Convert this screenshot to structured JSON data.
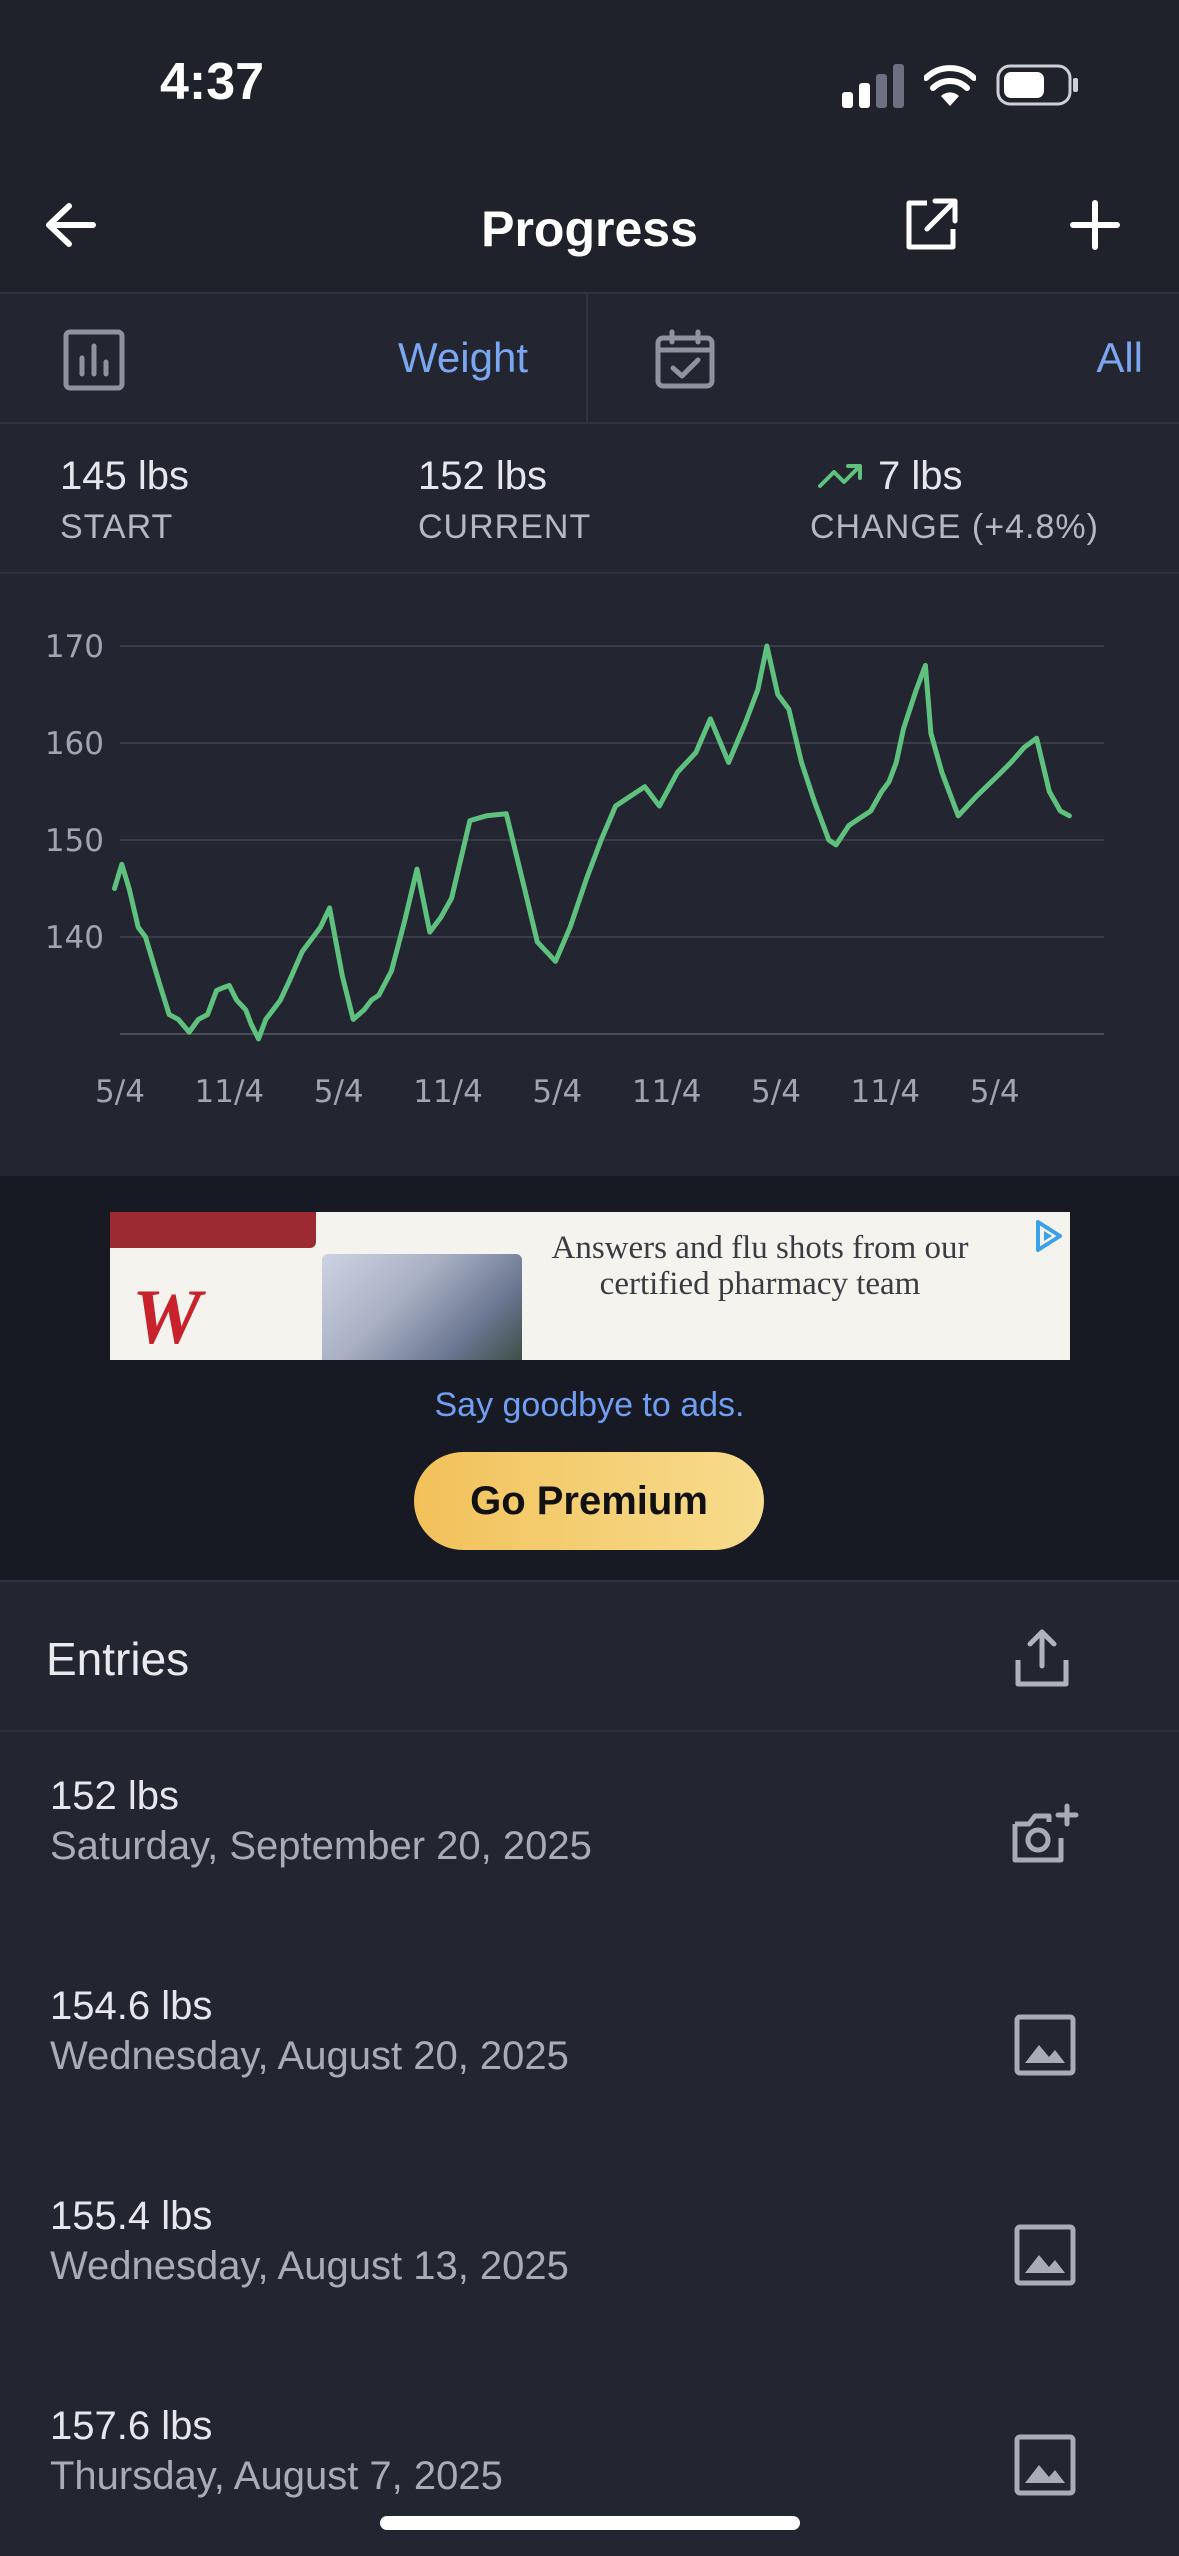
{
  "status_bar": {
    "time": "4:37"
  },
  "nav": {
    "title": "Progress"
  },
  "selector": {
    "metric": "Weight",
    "range": "All"
  },
  "stats": {
    "start_value": "145 lbs",
    "start_label": "START",
    "current_value": "152 lbs",
    "current_label": "CURRENT",
    "change_value": "7 lbs",
    "change_label": "CHANGE (+4.8%)"
  },
  "chart_data": {
    "type": "line",
    "title": "",
    "xlabel": "",
    "ylabel": "",
    "line_color": "#5fc17e",
    "y_ticks": [
      "140",
      "150",
      "160",
      "170"
    ],
    "x_ticks": [
      "5/4",
      "11/4",
      "5/4",
      "11/4",
      "5/4",
      "11/4",
      "5/4",
      "11/4",
      "5/4"
    ],
    "ylim": [
      130,
      170
    ],
    "x_range": [
      0,
      54
    ],
    "grid": true,
    "x": [
      -0.3,
      0.1,
      0.5,
      1.0,
      1.4,
      2.2,
      2.7,
      3.2,
      3.8,
      4.3,
      4.8,
      5.3,
      5.7,
      6.0,
      6.4,
      6.9,
      7.2,
      7.6,
      8.0,
      8.4,
      8.8,
      9.3,
      10.0,
      10.6,
      11.0,
      11.5,
      12.2,
      12.8,
      13.4,
      13.8,
      14.2,
      14.9,
      15.6,
      16.3,
      17.0,
      17.6,
      18.2,
      19.2,
      20.1,
      21.2,
      22.2,
      22.9,
      23.9,
      24.7,
      25.6,
      26.4,
      27.2,
      28.0,
      28.8,
      29.6,
      30.6,
      31.6,
      32.4,
      33.4,
      34.3,
      35.0,
      35.5,
      36.1,
      36.7,
      37.4,
      38.1,
      38.9,
      39.3,
      40.0,
      40.4,
      41.2,
      41.8,
      42.2,
      42.6,
      43.0,
      43.7,
      44.2,
      44.5,
      45.1,
      46.0,
      47.0,
      48.1,
      48.9,
      49.6,
      50.3,
      51.0,
      51.6,
      52.1,
      52.8,
      53.6,
      54.0
    ],
    "y": [
      145,
      147.5,
      145,
      141,
      140,
      135,
      132,
      131.5,
      130.2,
      131.5,
      132,
      134.5,
      134.8,
      135,
      133.5,
      132.5,
      131,
      129.5,
      131.5,
      132.5,
      133.5,
      135.5,
      138.5,
      140,
      141,
      143,
      136,
      131.5,
      132.5,
      133.5,
      134,
      136.5,
      141.5,
      147,
      140.5,
      142,
      144,
      152,
      152.5,
      152.7,
      145,
      139.5,
      137.5,
      141,
      146,
      150,
      153.5,
      154.5,
      155.5,
      153.5,
      157,
      159,
      162.5,
      158,
      162,
      165.5,
      170,
      165,
      163.5,
      158,
      154,
      150,
      149.5,
      151.5,
      152,
      153,
      155,
      156,
      158,
      161.5,
      165.5,
      168,
      161,
      157,
      152.5,
      154.5,
      156.5,
      158,
      159.5,
      160.5,
      155,
      153,
      152.5
    ]
  },
  "ad": {
    "text": "Answers and flu shots from our certified pharmacy team",
    "logo": "W",
    "goodbye_text": "Say goodbye to ads.",
    "premium_label": "Go Premium"
  },
  "entries": {
    "title": "Entries",
    "items": [
      {
        "value": "152 lbs",
        "date": "Saturday, September 20, 2025",
        "icon": "add-photo-icon"
      },
      {
        "value": "154.6 lbs",
        "date": "Wednesday, August 20, 2025",
        "icon": "image-icon"
      },
      {
        "value": "155.4 lbs",
        "date": "Wednesday, August 13, 2025",
        "icon": "image-icon"
      },
      {
        "value": "157.6 lbs",
        "date": "Thursday, August 7, 2025",
        "icon": "image-icon"
      }
    ]
  }
}
